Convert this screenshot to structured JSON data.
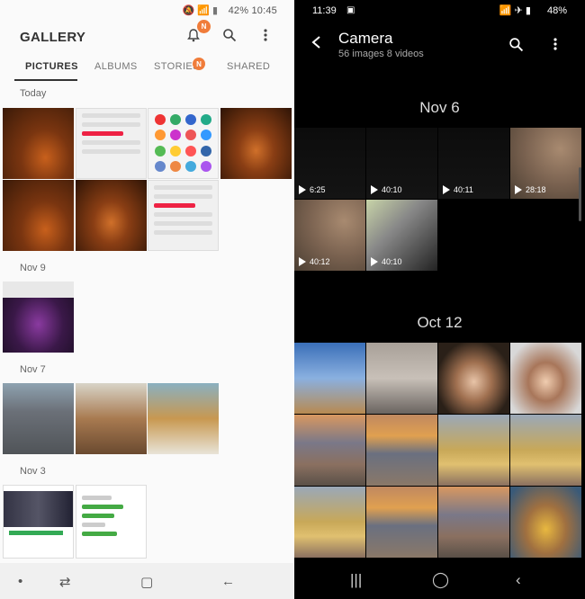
{
  "left": {
    "status": {
      "battery": "42%",
      "time": "10:45",
      "icons": "🔕 📶 ▮"
    },
    "title": "GALLERY",
    "notification_badge": "N",
    "tabs": [
      "PICTURES",
      "ALBUMS",
      "STORIES",
      "SHARED"
    ],
    "stories_badge": "N",
    "sections": [
      "Today",
      "Nov 9",
      "Nov 7",
      "Nov 3"
    ],
    "nav": {
      "dot": "•",
      "recents": "⇄",
      "home": "▢",
      "back": "←"
    }
  },
  "right": {
    "status": {
      "time": "11:39",
      "battery": "48%",
      "icons": "📶 ✈ ▮",
      "image_icon": "▣"
    },
    "back_icon": "‹",
    "title": "Camera",
    "subtitle": "56 images 8 videos",
    "dates": [
      "Nov 6",
      "Oct 12"
    ],
    "videos": [
      "6:25",
      "40:10",
      "40:11",
      "28:18",
      "40:12",
      "40:10"
    ],
    "nav": {
      "recents": "|||",
      "home": "◯",
      "back": "‹"
    }
  },
  "colors": {
    "badge": "#f07c3a",
    "dark_bg": "#000000",
    "light_bg": "#fafafa"
  }
}
